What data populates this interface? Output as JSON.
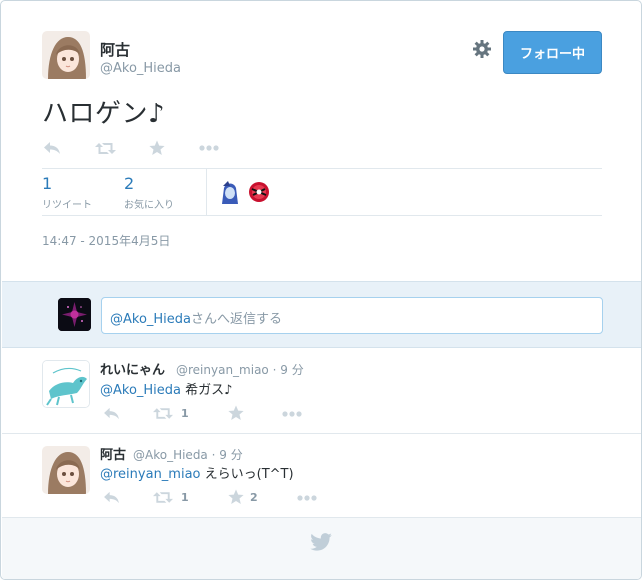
{
  "tweet": {
    "author_name": "阿古",
    "author_handle": "@Ako_Hieda",
    "follow_label": "フォロー中",
    "text": "ハロゲン♪",
    "retweet_count": "1",
    "retweet_label": "リツイート",
    "favorite_count": "2",
    "favorite_label": "お気に入り",
    "timestamp": "14:47 - 2015年4月5日"
  },
  "reply_box": {
    "mention": "@Ako_Hieda",
    "suffix": "さんへ返信する"
  },
  "replies": [
    {
      "name": "れいにゃん",
      "handle": "@reinyan_miao",
      "time": "· 9 分",
      "mention": "@Ako_Hieda",
      "text": " 希ガス♪",
      "retweets": "1",
      "favorites": ""
    },
    {
      "name": "阿古",
      "handle": "@Ako_Hieda",
      "time": "· 9 分",
      "mention": "@reinyan_miao",
      "text": " えらいっ(T^T)",
      "retweets": "1",
      "favorites": "2"
    }
  ],
  "icons": [
    "reply-icon",
    "retweet-icon",
    "favorite-icon",
    "more-icon",
    "gear-icon",
    "twitter-bird-icon"
  ],
  "colors": {
    "accent": "#4aa0e0",
    "link": "#2b7bb9",
    "muted": "#8899a6"
  }
}
